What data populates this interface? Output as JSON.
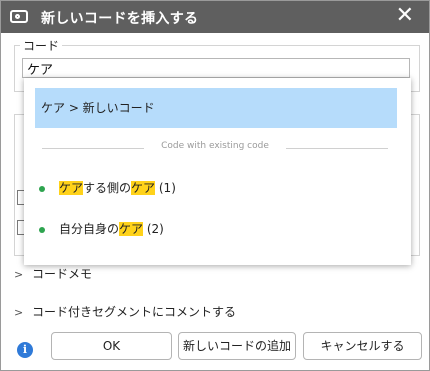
{
  "dialog": {
    "title": "新しいコードを挿入する",
    "close_glyph": "✕"
  },
  "code_field": {
    "label": "コード",
    "value": "ケア"
  },
  "dropdown": {
    "highlighted": "ケア > 新しいコード",
    "separator": "Code with existing code",
    "items": [
      {
        "pre": "",
        "hl1": "ケア",
        "mid": "する側の",
        "hl2": "ケア",
        "count": "(1)"
      },
      {
        "pre": "自分自身の",
        "hl1": "ケア",
        "mid": "",
        "hl2": "",
        "count": "(2)"
      }
    ]
  },
  "sections": {
    "memo": "コードメモ",
    "comment": "コード付きセグメントにコメントする"
  },
  "buttons": {
    "ok": "OK",
    "add": "新しいコードの追加",
    "cancel": "キャンセルする"
  },
  "colors": {
    "titlebar": "#5f5f5f",
    "highlight_bg": "#b6dcfb",
    "match_highlight": "#ffd21a",
    "dot": "#2ea44f",
    "info": "#2f7ad8"
  }
}
